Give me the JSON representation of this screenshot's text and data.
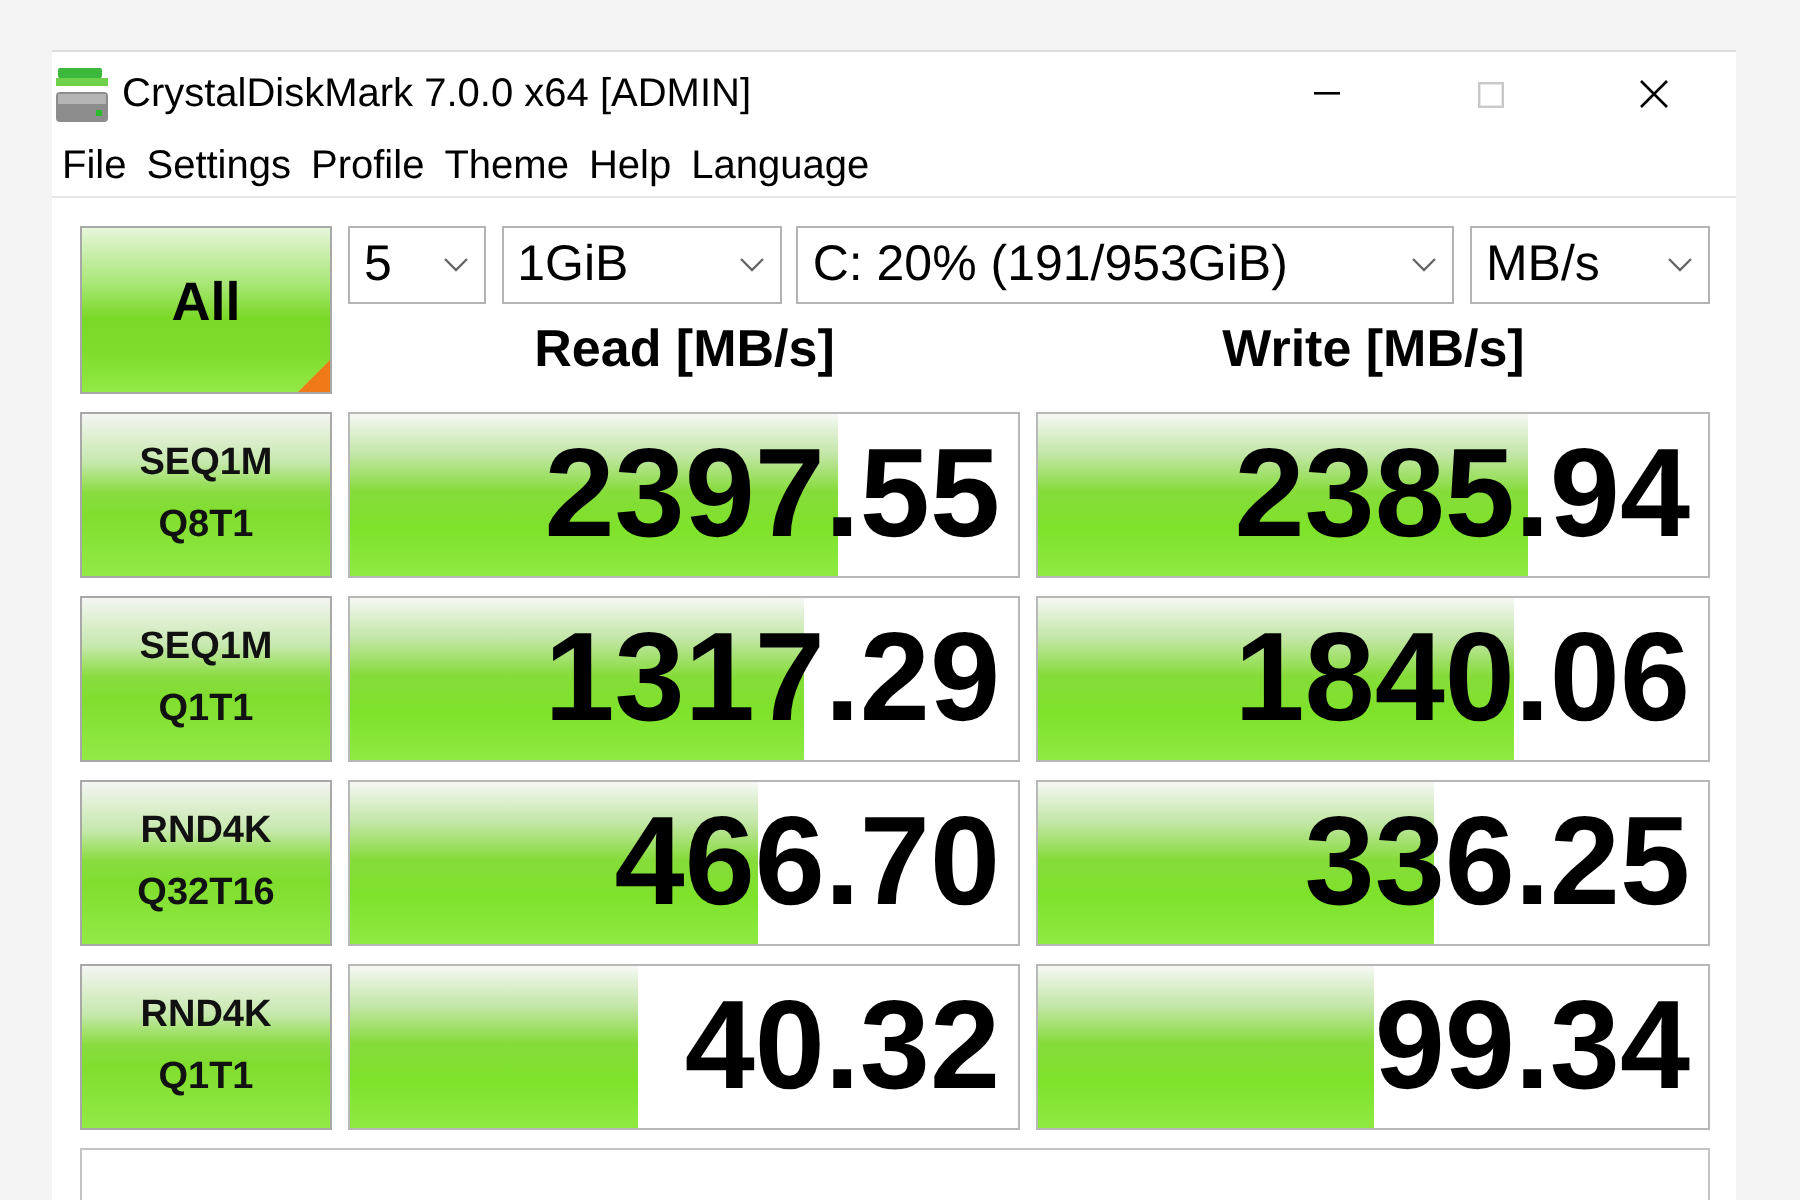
{
  "window": {
    "title": "CrystalDiskMark 7.0.0 x64 [ADMIN]",
    "maximize_disabled": true
  },
  "menu": [
    {
      "label": "File"
    },
    {
      "label": "Settings"
    },
    {
      "label": "Profile"
    },
    {
      "label": "Theme"
    },
    {
      "label": "Help"
    },
    {
      "label": "Language"
    }
  ],
  "controls": {
    "all_button": "All",
    "selects": [
      {
        "kind": "count",
        "value": "5"
      },
      {
        "kind": "size",
        "value": "1GiB"
      },
      {
        "kind": "drive",
        "value": "C: 20% (191/953GiB)"
      },
      {
        "kind": "unit",
        "value": "MB/s"
      }
    ]
  },
  "columns": [
    "Read [MB/s]",
    "Write [MB/s]"
  ],
  "tests": [
    {
      "label": [
        "SEQ1M",
        "Q8T1"
      ],
      "read": {
        "value": "2397.55",
        "level": 0.73
      },
      "write": {
        "value": "2385.94",
        "level": 0.73
      }
    },
    {
      "label": [
        "SEQ1M",
        "Q1T1"
      ],
      "read": {
        "value": "1317.29",
        "level": 0.68
      },
      "write": {
        "value": "1840.06",
        "level": 0.71
      }
    },
    {
      "label": [
        "RND4K",
        "Q32T16"
      ],
      "read": {
        "value": "466.70",
        "level": 0.61
      },
      "write": {
        "value": "336.25",
        "level": 0.59
      }
    },
    {
      "label": [
        "RND4K",
        "Q1T1"
      ],
      "read": {
        "value": "40.32",
        "level": 0.43
      },
      "write": {
        "value": "99.34",
        "level": 0.5
      }
    }
  ]
}
